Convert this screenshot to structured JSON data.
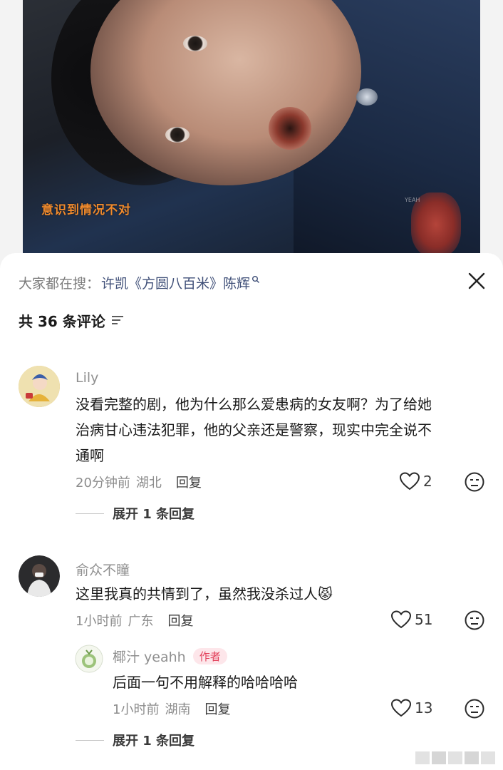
{
  "video": {
    "caption": "意识到情况不对",
    "watermark": "YEAH"
  },
  "search": {
    "prefix": "大家都在搜：",
    "query": "许凯《方圆八百米》陈辉"
  },
  "comments_header": {
    "count_label": "共 36 条评论"
  },
  "comments": [
    {
      "username": "Lily",
      "text_line1": "没看完整的剧，他为什么那么爱患病的女友啊？为了给她",
      "text_line2": "治病甘心违法犯罪，他的父亲还是警察，现实中完全说不",
      "text_line3": "通啊",
      "time": "20分钟前",
      "location": "湖北",
      "reply_label": "回复",
      "likes": "2",
      "expand_label": "展开 1 条回复"
    },
    {
      "username": "俞众不瞳",
      "text": "这里我真的共情到了，虽然我没杀过人",
      "emoji": "😾",
      "time": "1小时前",
      "location": "广东",
      "reply_label": "回复",
      "likes": "51",
      "reply": {
        "username": "椰汁 yeahh",
        "badge": "作者",
        "text": "后面一句不用解释的哈哈哈哈",
        "time": "1小时前",
        "location": "湖南",
        "reply_label": "回复",
        "likes": "13"
      },
      "expand_label": "展开 1 条回复"
    }
  ],
  "colors": {
    "link": "#3f4f78",
    "author_badge_bg": "#fde6ea",
    "author_badge_text": "#e2405a",
    "caption": "#f08a2c"
  }
}
